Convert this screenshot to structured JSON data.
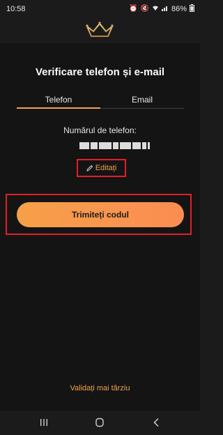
{
  "status_bar": {
    "time": "10:58",
    "battery": "86%",
    "icons": [
      "alarm-icon",
      "mute-icon",
      "wifi-icon",
      "signal-icon",
      "battery-icon"
    ]
  },
  "header": {
    "logo": "crown-logo",
    "accent_color": "#f4a24f"
  },
  "screen": {
    "title": "Verificare telefon și e-mail",
    "tabs": [
      {
        "label": "Telefon",
        "active": true
      },
      {
        "label": "Email",
        "active": false
      }
    ],
    "phone_label": "Numărul de telefon:",
    "edit_label": "Editați",
    "send_code_label": "Trimiteți codul",
    "validate_later_label": "Validați mai târziu"
  },
  "nav_bar": {
    "buttons": [
      "recent-apps-icon",
      "home-icon",
      "back-icon"
    ]
  },
  "colors": {
    "background": "#141414",
    "accent": "#f4a24f",
    "button_gradient_start": "#f6a048",
    "button_gradient_end": "#fa8d52",
    "highlight_border": "#e0202a"
  }
}
